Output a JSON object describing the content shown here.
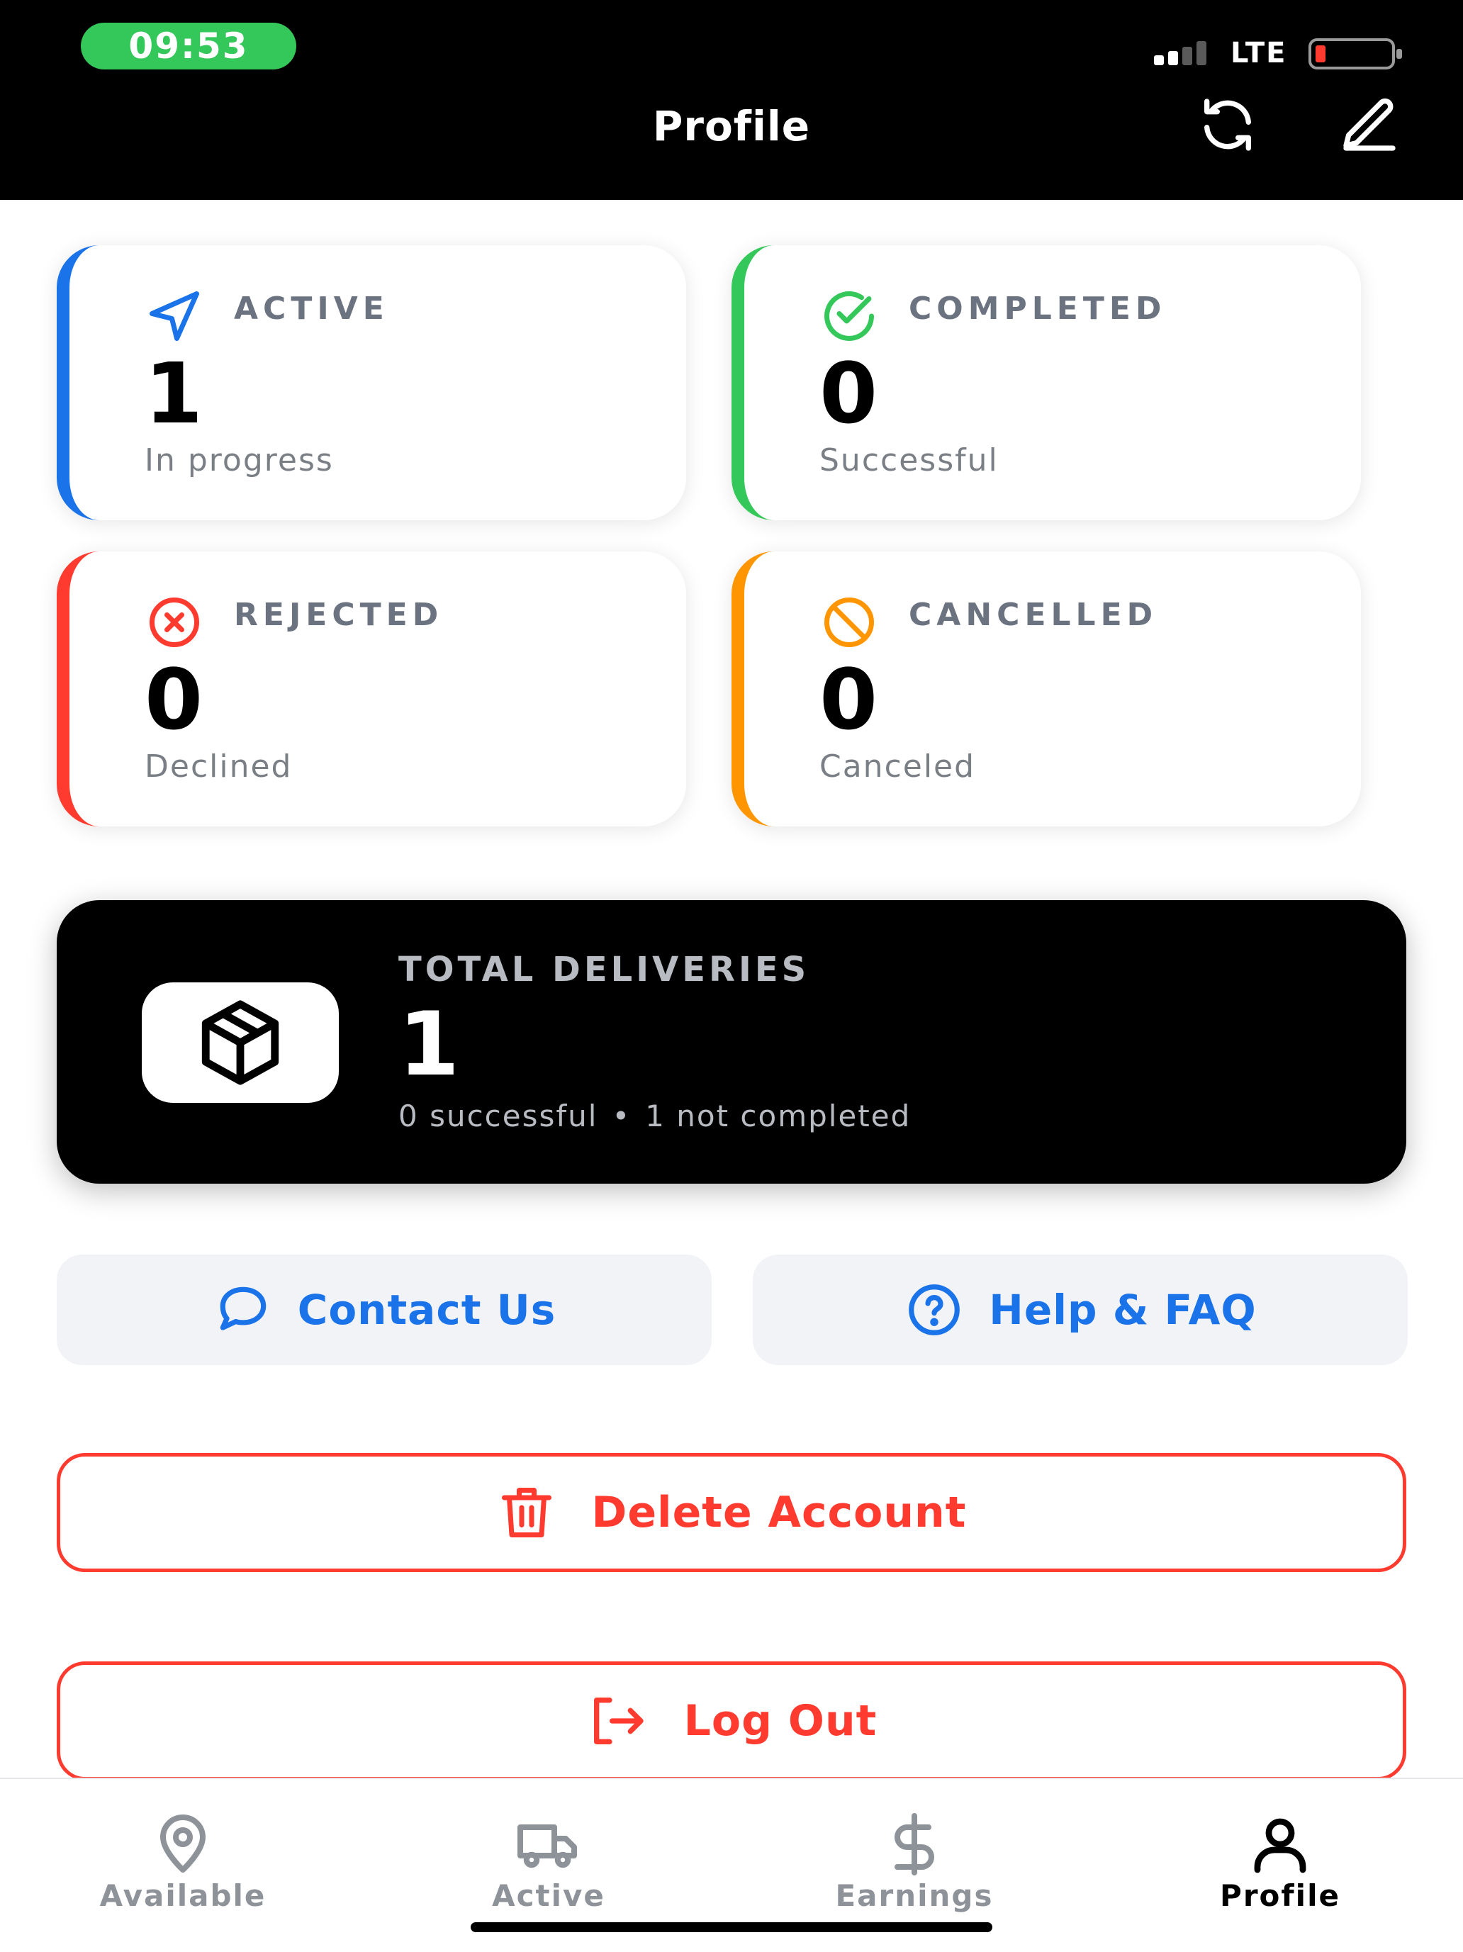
{
  "status_bar": {
    "time": "09:53",
    "network": "LTE"
  },
  "header": {
    "title": "Profile"
  },
  "stats": {
    "active": {
      "label": "ACTIVE",
      "value": "1",
      "sub": "In progress"
    },
    "completed": {
      "label": "COMPLETED",
      "value": "0",
      "sub": "Successful"
    },
    "rejected": {
      "label": "REJECTED",
      "value": "0",
      "sub": "Declined"
    },
    "cancelled": {
      "label": "CANCELLED",
      "value": "0",
      "sub": "Canceled"
    }
  },
  "total": {
    "label": "TOTAL DELIVERIES",
    "value": "1",
    "successful": "0 successful",
    "dot": "•",
    "not_completed": "1 not completed"
  },
  "support": {
    "contact_label": "Contact Us",
    "help_label": "Help & FAQ"
  },
  "account": {
    "delete_label": "Delete Account",
    "logout_label": "Log Out"
  },
  "tabs": [
    {
      "label": "Available",
      "icon": "location-pin-icon"
    },
    {
      "label": "Active",
      "icon": "truck-icon"
    },
    {
      "label": "Earnings",
      "icon": "dollar-icon"
    },
    {
      "label": "Profile",
      "icon": "user-icon"
    }
  ],
  "colors": {
    "blue": "#1a73e8",
    "green": "#34c759",
    "red": "#ff3b30",
    "orange": "#ff9500",
    "dark": "#000000"
  }
}
